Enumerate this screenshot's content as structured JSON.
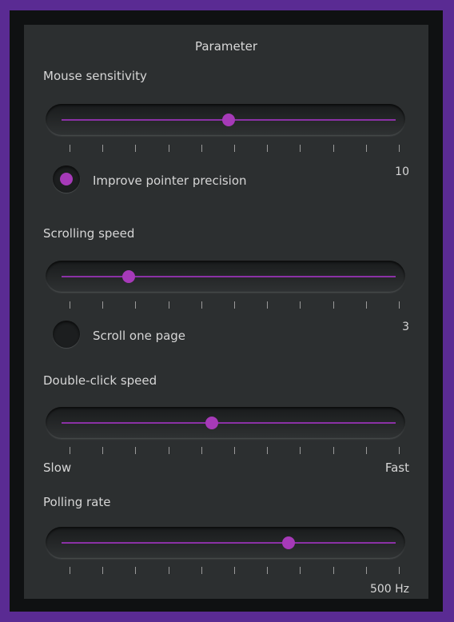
{
  "panel": {
    "title": "Parameter"
  },
  "mouse_sensitivity": {
    "label": "Mouse sensitivity",
    "level": 0.5,
    "option_label": "Improve pointer precision",
    "option_checked": true,
    "value": "10"
  },
  "scrolling_speed": {
    "label": "Scrolling speed",
    "level": 0.2,
    "option_label": "Scroll one page",
    "option_checked": false,
    "value": "3"
  },
  "double_click_speed": {
    "label": "Double-click speed",
    "level": 0.45,
    "min_label": "Slow",
    "max_label": "Fast"
  },
  "polling_rate": {
    "label": "Polling rate",
    "level": 0.68,
    "value": "500 Hz"
  },
  "colors": {
    "accent": "#a63ab8",
    "frame": "#5a2b93",
    "panel": "#2c2f30"
  }
}
